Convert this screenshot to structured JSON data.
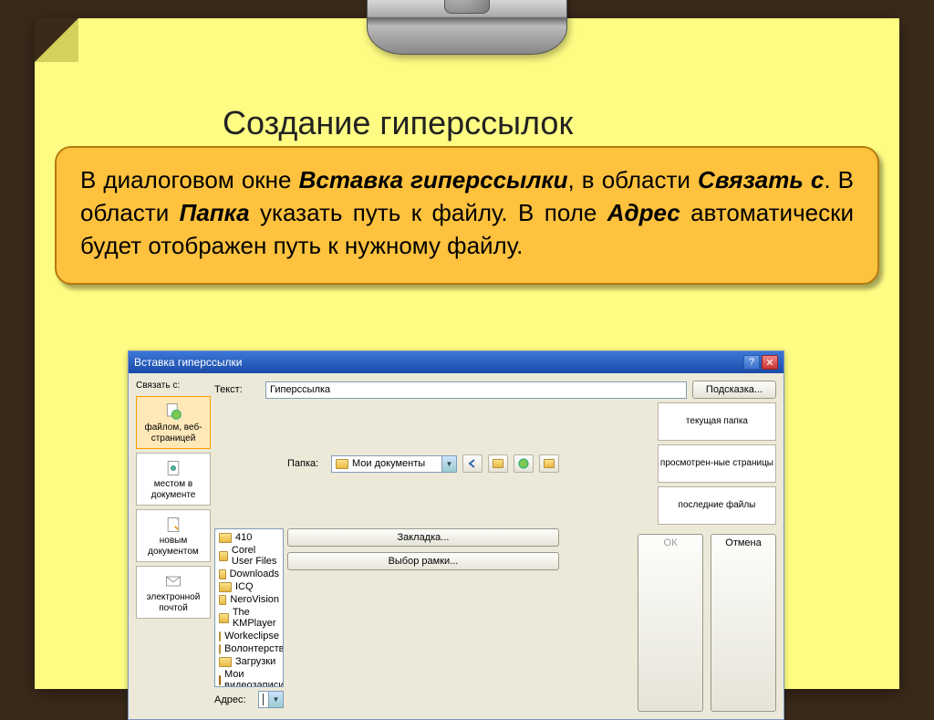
{
  "slide": {
    "title": "Создание гиперссылок",
    "callout_pre": "В диалоговом окне ",
    "callout_b1": "Вставка гиперссылки",
    "callout_mid1": ", в области ",
    "callout_b2": "Связать с",
    "callout_mid2": ". В области ",
    "callout_b3": "Папка",
    "callout_mid3": " указать путь к файлу. В поле ",
    "callout_b4": "Адрес",
    "callout_end": " автоматически будет отображен путь к нужному файлу."
  },
  "dialog": {
    "title": "Вставка гиперссылки",
    "help": "?",
    "close": "✕",
    "link_label": "Связать с:",
    "link_items": [
      "файлом, веб-страницей",
      "местом в документе",
      "новым документом",
      "электронной почтой"
    ],
    "text_label": "Текст:",
    "text_value": "Гиперссылка",
    "folder_label": "Папка:",
    "folder_value": "Мои документы",
    "browse_items": [
      "текущая папка",
      "просмотрен-ные страницы",
      "последние файлы"
    ],
    "files": [
      {
        "t": "folder",
        "n": "410"
      },
      {
        "t": "folder",
        "n": "Corel User Files"
      },
      {
        "t": "folder",
        "n": "Downloads"
      },
      {
        "t": "folder",
        "n": "ICQ"
      },
      {
        "t": "folder",
        "n": "NeroVision"
      },
      {
        "t": "folder",
        "n": "The KMPlayer"
      },
      {
        "t": "folder",
        "n": "Workeclipse"
      },
      {
        "t": "folder",
        "n": "Волонтерство"
      },
      {
        "t": "folder",
        "n": "Загрузки"
      },
      {
        "t": "video",
        "n": "Мои видеозаписи"
      }
    ],
    "address_label": "Адрес:",
    "address_value": "",
    "btn_tip": "Подсказка...",
    "btn_bookmark": "Закладка...",
    "btn_frame": "Выбор рамки...",
    "btn_ok": "ОК",
    "btn_cancel": "Отмена"
  }
}
